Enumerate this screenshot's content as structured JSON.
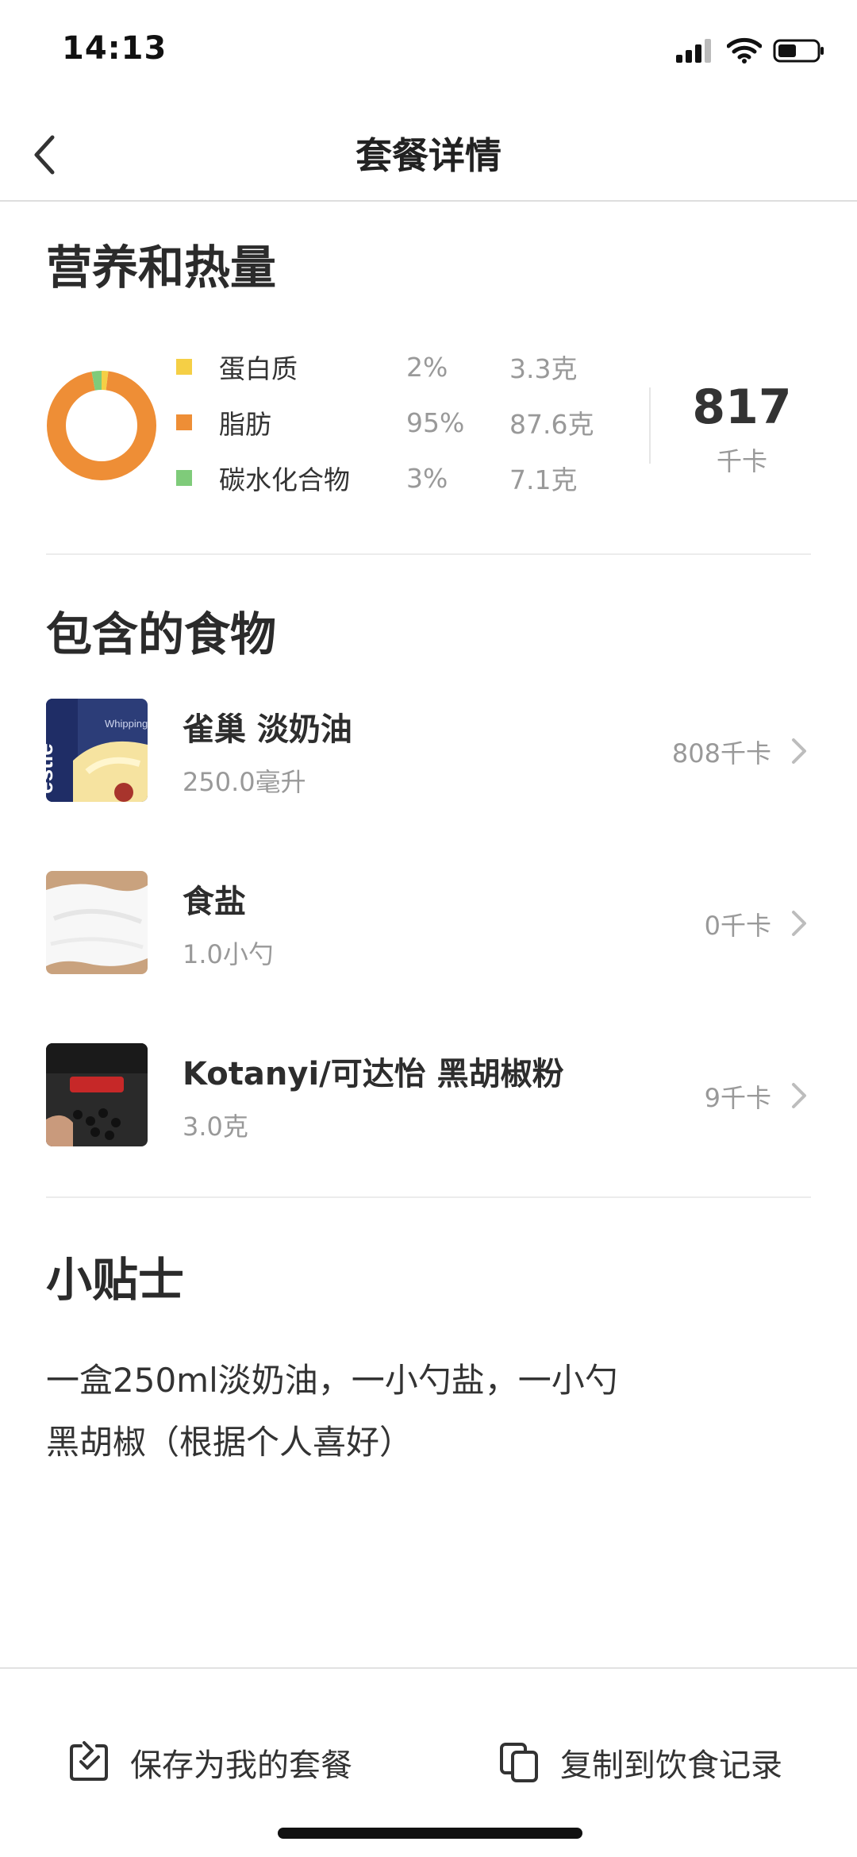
{
  "status_bar": {
    "time": "14:13"
  },
  "nav": {
    "title": "套餐详情"
  },
  "nutrition": {
    "section_title": "营养和热量",
    "items": [
      {
        "name": "蛋白质",
        "percent": "2%",
        "amount": "3.3克",
        "color": "#F5CF45",
        "share": 0.02
      },
      {
        "name": "脂肪",
        "percent": "95%",
        "amount": "87.6克",
        "color": "#EE8E36",
        "share": 0.95
      },
      {
        "name": "碳水化合物",
        "percent": "3%",
        "amount": "7.1克",
        "color": "#7FCB7A",
        "share": 0.03
      }
    ],
    "calories": {
      "value": "817",
      "unit": "千卡"
    }
  },
  "foods": {
    "section_title": "包含的食物",
    "items": [
      {
        "name": "雀巢 淡奶油",
        "amount": "250.0毫升",
        "calories": "808千卡",
        "image": "whipping-cream-box"
      },
      {
        "name": "食盐",
        "amount": "1.0小勺",
        "calories": "0千卡",
        "image": "salt-pile"
      },
      {
        "name": "Kotanyi/可达怡 黑胡椒粉",
        "amount": "3.0克",
        "calories": "9千卡",
        "image": "black-pepper-package"
      }
    ]
  },
  "tips": {
    "section_title": "小贴士",
    "line1": "一盒250ml淡奶油，一小勺盐，一小勺",
    "line2": "黑胡椒（根据个人喜好）"
  },
  "bottom_bar": {
    "save_label": "保存为我的套餐",
    "copy_label": "复制到饮食记录"
  }
}
